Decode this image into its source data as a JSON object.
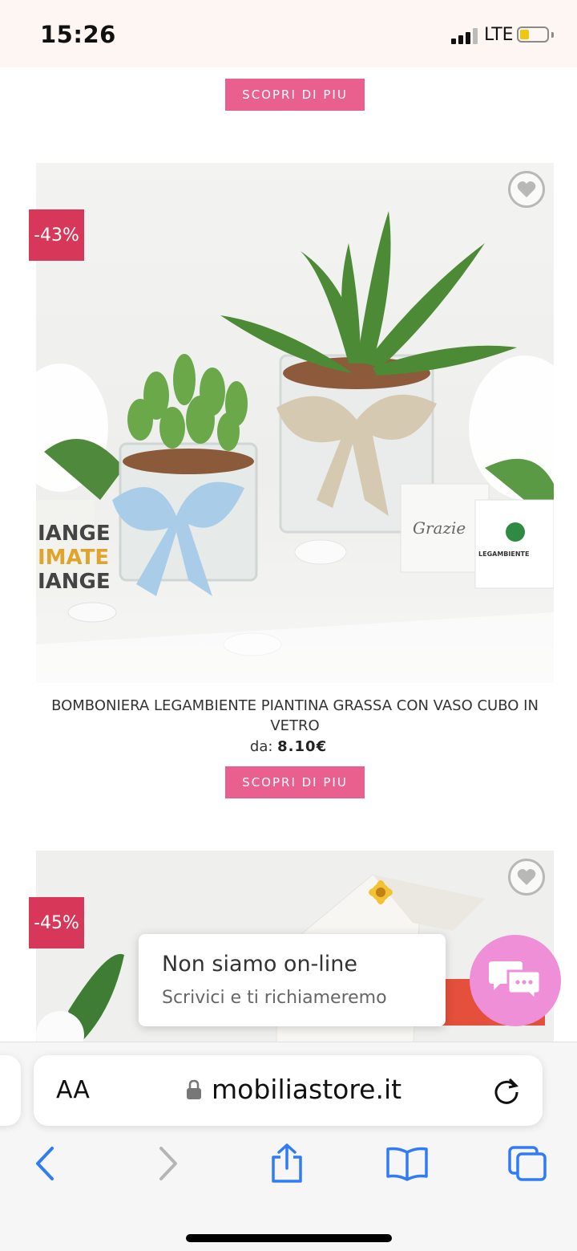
{
  "status_bar": {
    "time": "15:26",
    "network": "LTE",
    "battery_level": 0.35
  },
  "top_button": {
    "label": "SCOPRI DI PIU"
  },
  "products": [
    {
      "discount": "-43%",
      "title": "BOMBONIERA LEGAMBIENTE PIANTINA GRASSA CON VASO CUBO IN VETRO",
      "price_prefix": "da:",
      "price": "8.10€",
      "button_label": "SCOPRI DI PIU",
      "image_text": {
        "left_card_lines": [
          "IANGE",
          "IMATE",
          "IANGE"
        ],
        "right_card_word": "Grazie",
        "right_card_brand": "LEGAMBIENTE"
      }
    },
    {
      "discount": "-45%"
    }
  ],
  "chat": {
    "title": "Non siamo on-line",
    "subtitle": "Scrivici e ti richiameremo"
  },
  "browser": {
    "text_size_label": "AA",
    "url": "mobiliastore.it"
  },
  "icons": [
    "heart-icon",
    "lock-icon",
    "reload-icon",
    "back-icon",
    "forward-icon",
    "share-icon",
    "bookmarks-icon",
    "tabs-icon",
    "chat-icon"
  ],
  "colors": {
    "button_pink": "#e9608f",
    "badge_red": "#d7385a",
    "chat_pink": "#ef8fd7",
    "ios_blue": "#2f7cf6"
  }
}
